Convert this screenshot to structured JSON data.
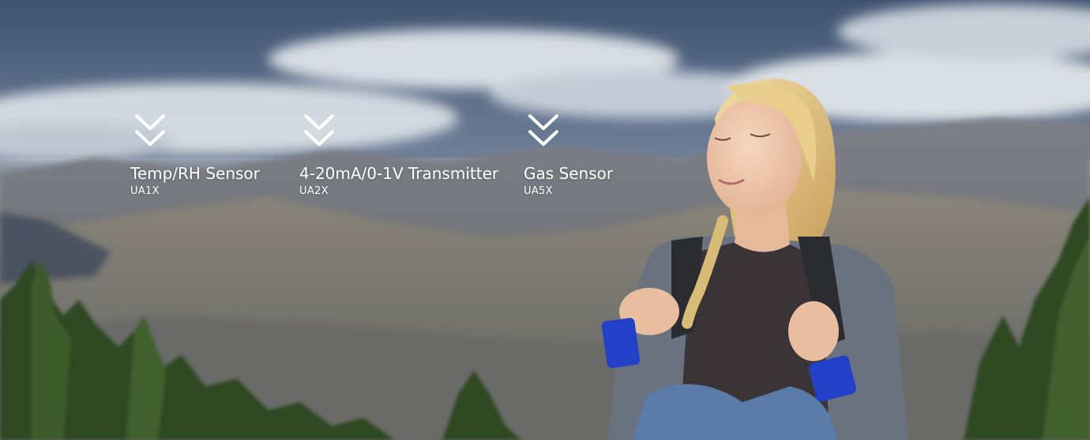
{
  "hero": {
    "nav_items": [
      {
        "title": "Temp/RH Sensor",
        "code": "UA1X",
        "icon": "double-chevron-down-icon"
      },
      {
        "title": "4-20mA/0-1V Transmitter",
        "code": "UA2X",
        "icon": "double-chevron-down-icon"
      },
      {
        "title": "Gas Sensor",
        "code": "UA5X",
        "icon": "double-chevron-down-icon"
      }
    ]
  },
  "colors": {
    "text": "#ffffff",
    "sky": "#4d5f7a",
    "cloud": "#dfe4ea",
    "forest": "#2f4a24",
    "hair": "#d9bb78",
    "sleeve_accent": "#2340c8"
  }
}
